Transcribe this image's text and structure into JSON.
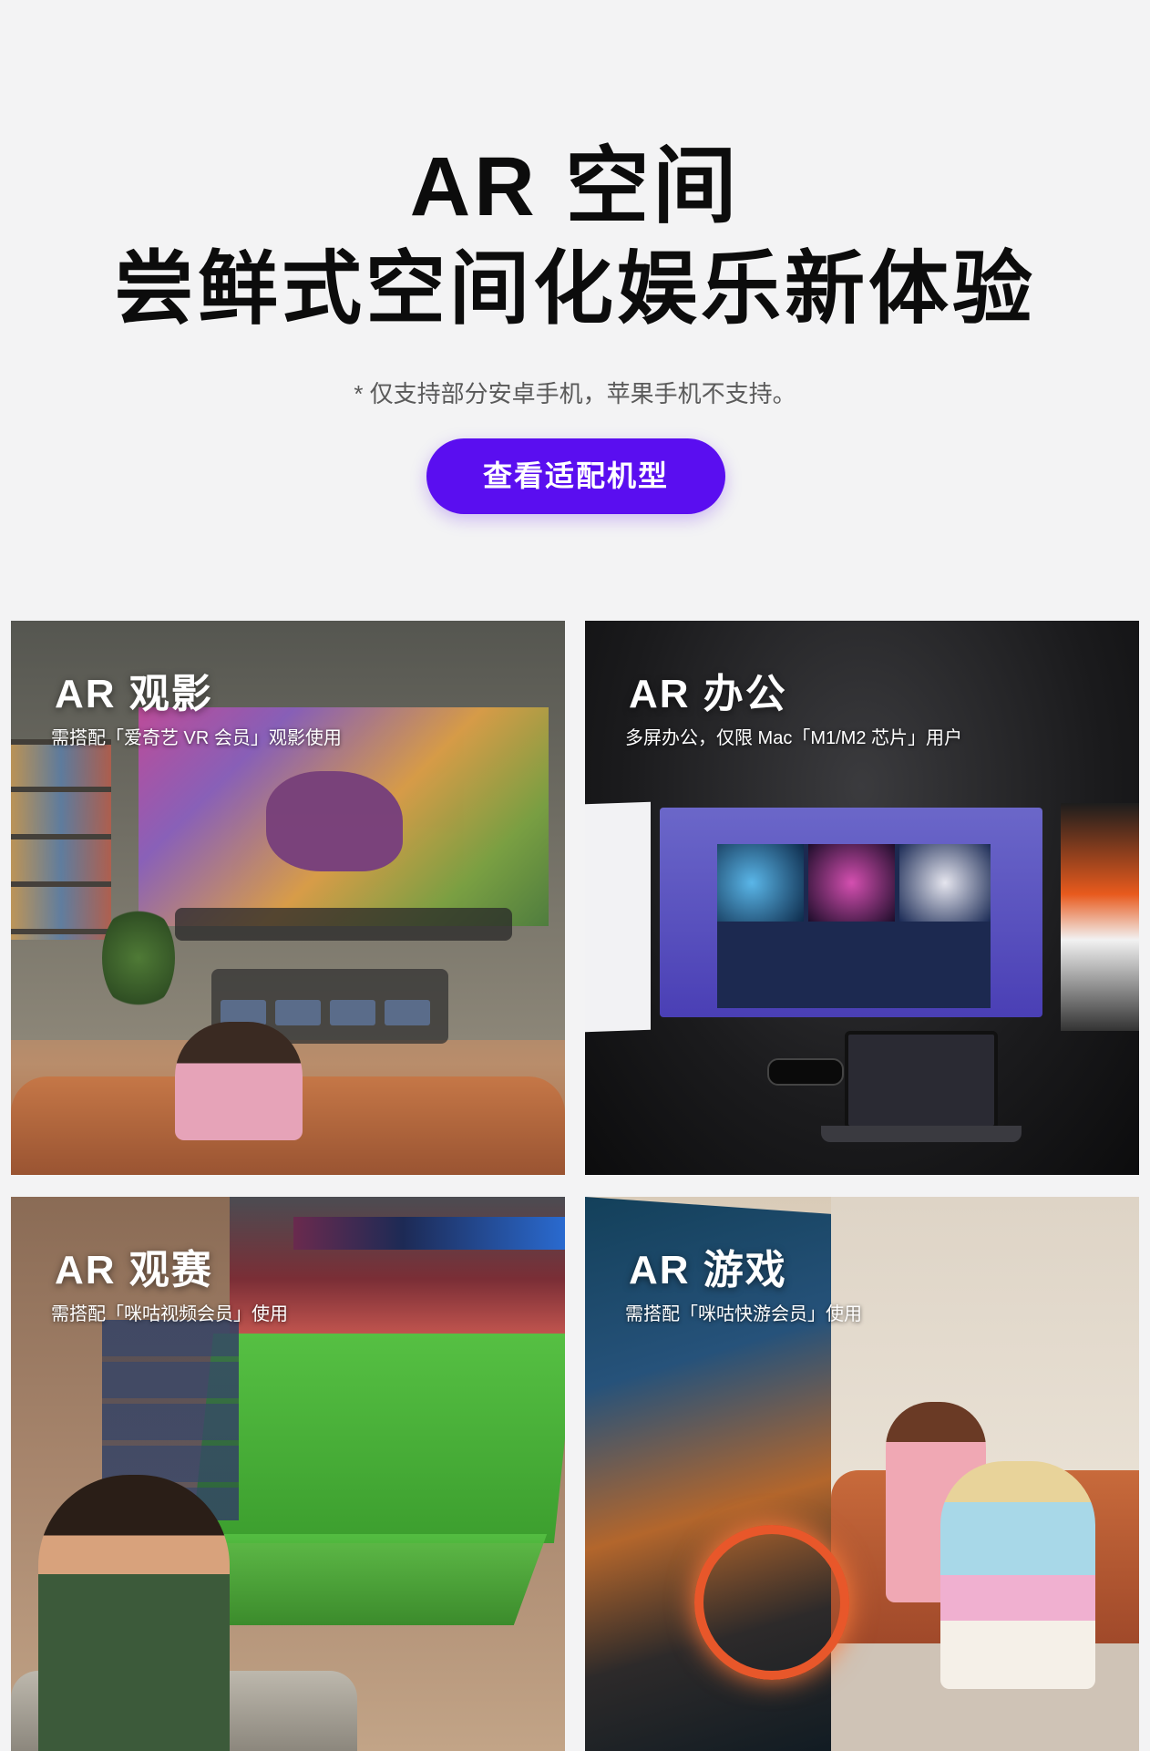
{
  "hero": {
    "title_line1": "AR 空间",
    "title_line2": "尝鲜式空间化娱乐新体验",
    "note": "* 仅支持部分安卓手机，苹果手机不支持。",
    "button_label": "查看适配机型",
    "button_color": "#5a0ef0"
  },
  "tiles": [
    {
      "title": "AR 观影",
      "subtitle": "需搭配「爱奇艺 VR 会员」观影使用"
    },
    {
      "title": "AR 办公",
      "subtitle": "多屏办公，仅限 Mac「M1/M2 芯片」用户"
    },
    {
      "title": "AR 观赛",
      "subtitle": "需搭配「咪咕视频会员」使用"
    },
    {
      "title": "AR 游戏",
      "subtitle": "需搭配「咪咕快游会员」使用"
    }
  ]
}
